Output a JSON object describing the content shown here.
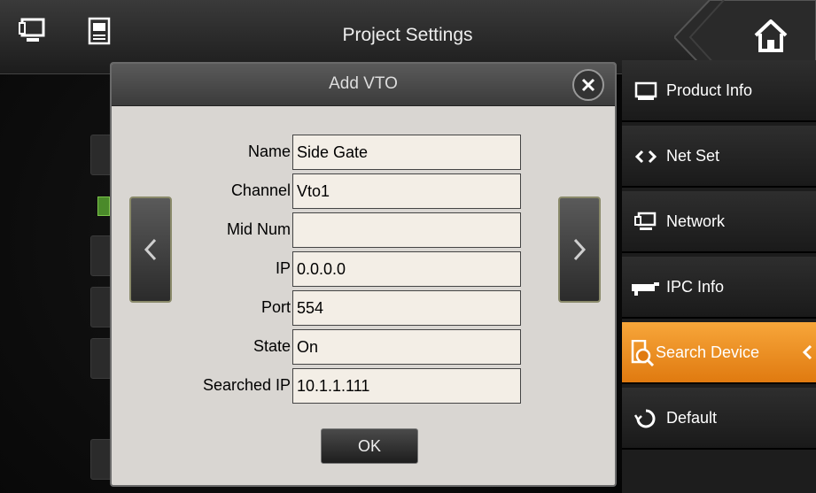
{
  "header": {
    "title": "Project Settings"
  },
  "sidebar": {
    "items": [
      {
        "label": "Product Info",
        "icon": "monitor-icon"
      },
      {
        "label": "Net Set",
        "icon": "code-arrows-icon"
      },
      {
        "label": "Network",
        "icon": "network-monitor-icon"
      },
      {
        "label": "IPC Info",
        "icon": "camera-icon"
      },
      {
        "label": "Search Device",
        "icon": "search-device-icon",
        "active": true
      },
      {
        "label": "Default",
        "icon": "recycle-icon"
      }
    ]
  },
  "dialog": {
    "title": "Add VTO",
    "fields": [
      {
        "label": "Name",
        "value": "Side Gate"
      },
      {
        "label": "Channel",
        "value": "Vto1"
      },
      {
        "label": "Mid Num",
        "value": ""
      },
      {
        "label": "IP",
        "value": "0.0.0.0"
      },
      {
        "label": "Port",
        "value": "554"
      },
      {
        "label": "State",
        "value": "On"
      },
      {
        "label": "Searched IP",
        "value": "10.1.1.111"
      }
    ],
    "ok_label": "OK"
  },
  "colors": {
    "accent": "#f0901f",
    "dialog_bg": "#d9d6d2",
    "input_bg": "#f3eee6"
  }
}
